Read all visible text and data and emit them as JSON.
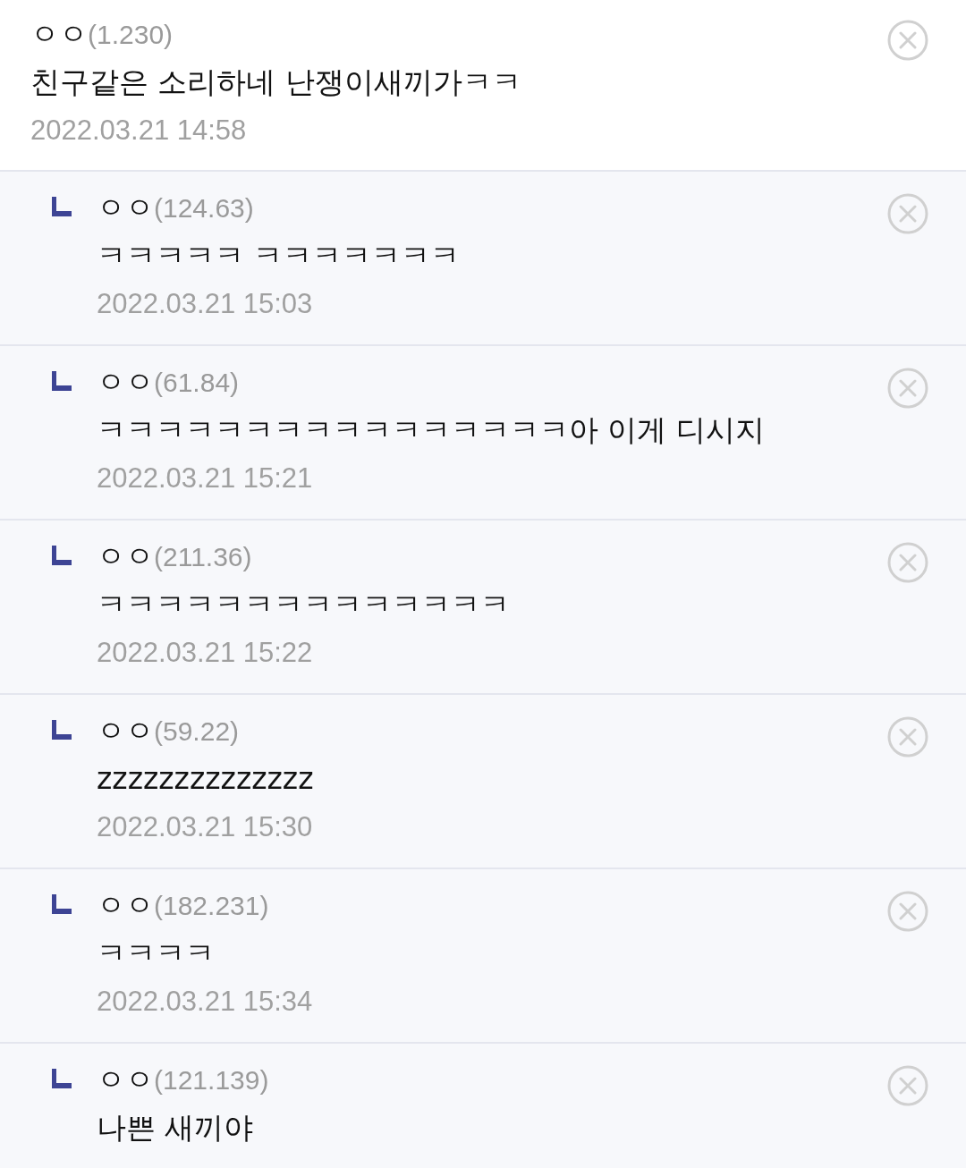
{
  "comments": [
    {
      "kind": "comment",
      "name": "ㅇㅇ",
      "ip": "(1.230)",
      "text": "친구같은 소리하네 난쟁이새끼가ㅋㅋ",
      "date": "2022.03.21 14:58"
    },
    {
      "kind": "reply",
      "name": "ㅇㅇ",
      "ip": "(124.63)",
      "text": "ㅋㅋㅋㅋㅋ ㅋㅋㅋㅋㅋㅋㅋ",
      "date": "2022.03.21 15:03"
    },
    {
      "kind": "reply",
      "name": "ㅇㅇ",
      "ip": "(61.84)",
      "text": "ㅋㅋㅋㅋㅋㅋㅋㅋㅋㅋㅋㅋㅋㅋㅋㅋ아 이게 디시지",
      "date": "2022.03.21 15:21"
    },
    {
      "kind": "reply",
      "name": "ㅇㅇ",
      "ip": "(211.36)",
      "text": "ㅋㅋㅋㅋㅋㅋㅋㅋㅋㅋㅋㅋㅋㅋ",
      "date": "2022.03.21 15:22"
    },
    {
      "kind": "reply",
      "name": "ㅇㅇ",
      "ip": "(59.22)",
      "text": "zzzzzzzzzzzzzz",
      "date": "2022.03.21 15:30"
    },
    {
      "kind": "reply",
      "name": "ㅇㅇ",
      "ip": "(182.231)",
      "text": "ㅋㅋㅋㅋ",
      "date": "2022.03.21 15:34"
    },
    {
      "kind": "reply",
      "name": "ㅇㅇ",
      "ip": "(121.139)",
      "text": "나쁜 새끼야"
    }
  ]
}
